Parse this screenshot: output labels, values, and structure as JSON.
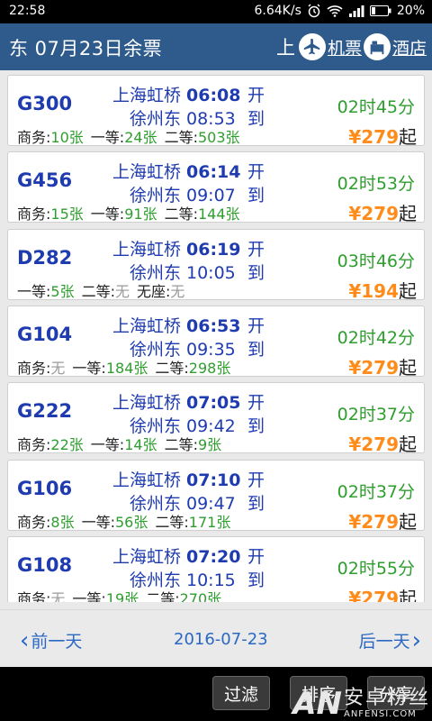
{
  "status_bar": {
    "time": "22:58",
    "speed": "6.64K/s",
    "battery": "20%"
  },
  "header": {
    "title": "东 07月23日余票",
    "prefix": "上",
    "flight_label": "机票",
    "hotel_label": "酒店"
  },
  "trains": [
    {
      "code": "G300",
      "depart_station": "上海虹桥",
      "depart_time": "06:08",
      "depart_action": "开",
      "arrive_station": "徐州东",
      "arrive_time": "08:53",
      "arrive_action": "到",
      "duration": "02时45分",
      "seats": [
        {
          "label": "商务:",
          "value": "10张"
        },
        {
          "label": "一等:",
          "value": "24张"
        },
        {
          "label": "二等:",
          "value": "503张"
        }
      ],
      "price": "279",
      "price_suffix": "起"
    },
    {
      "code": "G456",
      "depart_station": "上海虹桥",
      "depart_time": "06:14",
      "depart_action": "开",
      "arrive_station": "徐州东",
      "arrive_time": "09:07",
      "arrive_action": "到",
      "duration": "02时53分",
      "seats": [
        {
          "label": "商务:",
          "value": "15张"
        },
        {
          "label": "一等:",
          "value": "91张"
        },
        {
          "label": "二等:",
          "value": "144张"
        }
      ],
      "price": "279",
      "price_suffix": "起"
    },
    {
      "code": "D282",
      "depart_station": "上海虹桥",
      "depart_time": "06:19",
      "depart_action": "开",
      "arrive_station": "徐州东",
      "arrive_time": "10:05",
      "arrive_action": "到",
      "duration": "03时46分",
      "seats": [
        {
          "label": "一等:",
          "value": "5张"
        },
        {
          "label": "二等:",
          "value": "无"
        },
        {
          "label": "无座:",
          "value": "无"
        }
      ],
      "price": "194",
      "price_suffix": "起"
    },
    {
      "code": "G104",
      "depart_station": "上海虹桥",
      "depart_time": "06:53",
      "depart_action": "开",
      "arrive_station": "徐州东",
      "arrive_time": "09:35",
      "arrive_action": "到",
      "duration": "02时42分",
      "seats": [
        {
          "label": "商务:",
          "value": "无"
        },
        {
          "label": "一等:",
          "value": "184张"
        },
        {
          "label": "二等:",
          "value": "298张"
        }
      ],
      "price": "279",
      "price_suffix": "起"
    },
    {
      "code": "G222",
      "depart_station": "上海虹桥",
      "depart_time": "07:05",
      "depart_action": "开",
      "arrive_station": "徐州东",
      "arrive_time": "09:42",
      "arrive_action": "到",
      "duration": "02时37分",
      "seats": [
        {
          "label": "商务:",
          "value": "22张"
        },
        {
          "label": "一等:",
          "value": "14张"
        },
        {
          "label": "二等:",
          "value": "9张"
        }
      ],
      "price": "279",
      "price_suffix": "起"
    },
    {
      "code": "G106",
      "depart_station": "上海虹桥",
      "depart_time": "07:10",
      "depart_action": "开",
      "arrive_station": "徐州东",
      "arrive_time": "09:47",
      "arrive_action": "到",
      "duration": "02时37分",
      "seats": [
        {
          "label": "商务:",
          "value": "8张"
        },
        {
          "label": "一等:",
          "value": "56张"
        },
        {
          "label": "二等:",
          "value": "171张"
        }
      ],
      "price": "279",
      "price_suffix": "起"
    },
    {
      "code": "G108",
      "depart_station": "上海虹桥",
      "depart_time": "07:20",
      "depart_action": "开",
      "arrive_station": "徐州东",
      "arrive_time": "10:15",
      "arrive_action": "到",
      "duration": "02时55分",
      "seats": [
        {
          "label": "商务:",
          "value": "无"
        },
        {
          "label": "一等:",
          "value": "19张"
        },
        {
          "label": "二等:",
          "value": "270张"
        }
      ],
      "price": "279",
      "price_suffix": "起"
    }
  ],
  "currency_symbol": "¥",
  "date_nav": {
    "prev_label": "前一天",
    "date": "2016-07-23",
    "next_label": "后一天"
  },
  "actions": {
    "filter_label": "过滤",
    "sort_label": "排序",
    "share_label": "分享"
  },
  "watermark": {
    "logo": "AN",
    "cn": "安卓粉丝",
    "en": "ANFENSI.COM"
  },
  "colors": {
    "header_bg": "#2e5a8c",
    "train_blue": "#1f3bb0",
    "duration_green": "#2e9e2e",
    "price_orange": "#ff8c1a",
    "none_gray": "#9a9a9a",
    "link_blue": "#2a68c4"
  }
}
